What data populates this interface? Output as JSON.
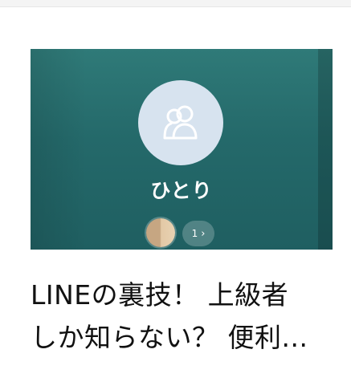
{
  "thumbnail": {
    "group_name": "ひとり",
    "member_count": "1",
    "icon": "group-people-icon",
    "avatar_icon": "member-avatar"
  },
  "article": {
    "title_line1": "LINEの裏技！ 上級者",
    "title_line2": "しか知らない？ 便利..."
  },
  "colors": {
    "thumbnail_bg": "#26706f",
    "avatar_circle": "#d7e3ef",
    "title_text": "#111111"
  }
}
